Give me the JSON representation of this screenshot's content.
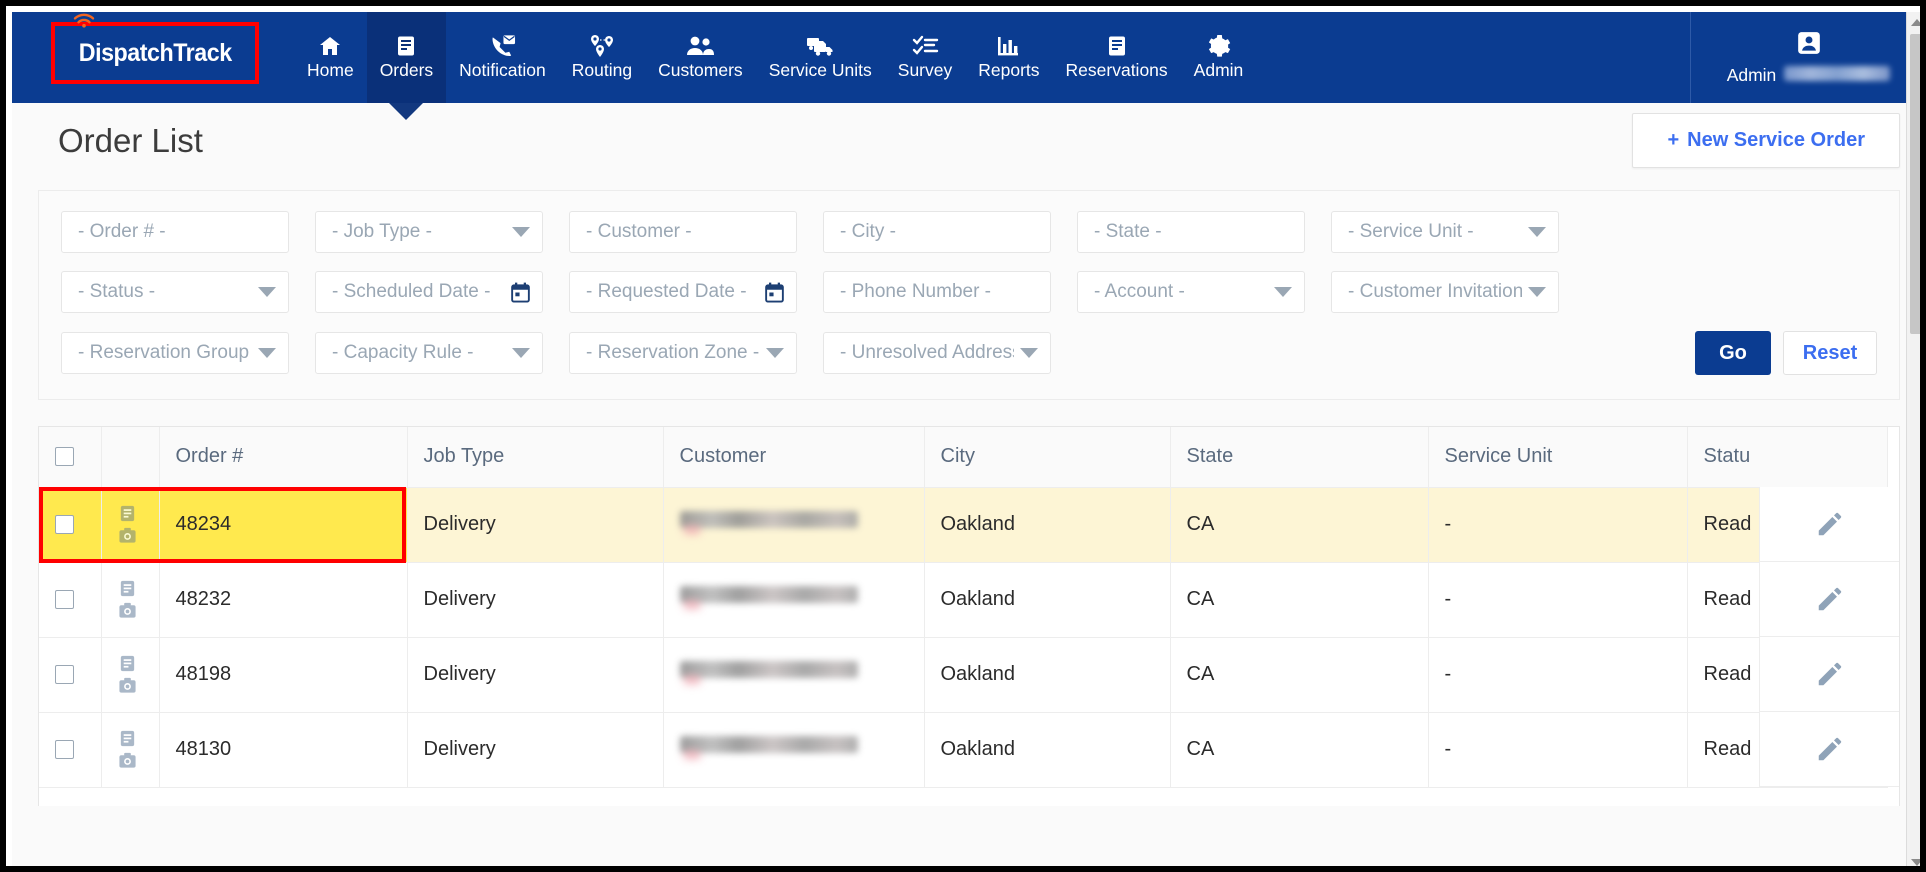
{
  "nav": {
    "logo_text": "DispatchTrack",
    "items": [
      {
        "label": "Home",
        "icon": "home-icon",
        "active": false
      },
      {
        "label": "Orders",
        "icon": "document-icon",
        "active": true
      },
      {
        "label": "Notification",
        "icon": "phone-message-icon",
        "active": false
      },
      {
        "label": "Routing",
        "icon": "map-pins-icon",
        "active": false
      },
      {
        "label": "Customers",
        "icon": "people-icon",
        "active": false
      },
      {
        "label": "Service Units",
        "icon": "trucks-icon",
        "active": false
      },
      {
        "label": "Survey",
        "icon": "checklist-icon",
        "active": false
      },
      {
        "label": "Reports",
        "icon": "bar-chart-icon",
        "active": false
      },
      {
        "label": "Reservations",
        "icon": "document-icon",
        "active": false
      },
      {
        "label": "Admin",
        "icon": "gear-icon",
        "active": false
      }
    ],
    "account": {
      "label": "Admin",
      "icon": "user-icon",
      "username_redacted": true
    }
  },
  "header": {
    "title": "Order List",
    "new_order_button": {
      "plus": "+",
      "label": "New Service Order"
    }
  },
  "filters": {
    "rows": [
      [
        {
          "placeholder": "- Order # -",
          "type": "text",
          "name": "order-number"
        },
        {
          "placeholder": "- Job Type -",
          "type": "select",
          "name": "job-type"
        },
        {
          "placeholder": "- Customer -",
          "type": "text",
          "name": "customer"
        },
        {
          "placeholder": "- City -",
          "type": "text",
          "name": "city"
        },
        {
          "placeholder": "- State -",
          "type": "text",
          "name": "state"
        },
        {
          "placeholder": "- Service Unit -",
          "type": "select",
          "name": "service-unit"
        }
      ],
      [
        {
          "placeholder": "- Status -",
          "type": "select",
          "name": "status"
        },
        {
          "placeholder": "- Scheduled Date -",
          "type": "date",
          "name": "scheduled-date"
        },
        {
          "placeholder": "- Requested Date -",
          "type": "date",
          "name": "requested-date"
        },
        {
          "placeholder": "- Phone Number -",
          "type": "text",
          "name": "phone-number"
        },
        {
          "placeholder": "- Account -",
          "type": "select",
          "name": "account"
        },
        {
          "placeholder": "- Customer Invitation -",
          "type": "select",
          "name": "customer-invitation"
        }
      ],
      [
        {
          "placeholder": "- Reservation Group -",
          "type": "select",
          "name": "reservation-group"
        },
        {
          "placeholder": "- Capacity Rule -",
          "type": "select",
          "name": "capacity-rule"
        },
        {
          "placeholder": "- Reservation Zone -",
          "type": "select",
          "name": "reservation-zone"
        },
        {
          "placeholder": "- Unresolved Address -",
          "type": "select",
          "name": "unresolved-address"
        }
      ]
    ],
    "go_label": "Go",
    "reset_label": "Reset"
  },
  "table": {
    "columns": [
      "",
      "",
      "Order #",
      "Job Type",
      "Customer",
      "City",
      "State",
      "Service Unit",
      "Statu"
    ],
    "rows": [
      {
        "order": "48234",
        "job_type": "Delivery",
        "customer_redacted": true,
        "city": "Oakland",
        "state": "CA",
        "service_unit": "-",
        "status": "Read",
        "highlighted": true
      },
      {
        "order": "48232",
        "job_type": "Delivery",
        "customer_redacted": true,
        "city": "Oakland",
        "state": "CA",
        "service_unit": "-",
        "status": "Read",
        "highlighted": false
      },
      {
        "order": "48198",
        "job_type": "Delivery",
        "customer_redacted": true,
        "city": "Oakland",
        "state": "CA",
        "service_unit": "-",
        "status": "Read",
        "highlighted": false
      },
      {
        "order": "48130",
        "job_type": "Delivery",
        "customer_redacted": true,
        "city": "Oakland",
        "state": "CA",
        "service_unit": "-",
        "status": "Read",
        "highlighted": false
      }
    ]
  },
  "colors": {
    "nav_blue": "#0b3c91",
    "nav_active_blue": "#0a3079",
    "link_blue": "#3c6ef0",
    "highlight_yellow": "#ffe94e",
    "row_tint_yellow": "#fdf5d5",
    "annotation_red": "#ff0000",
    "logo_orange": "#f26522"
  }
}
